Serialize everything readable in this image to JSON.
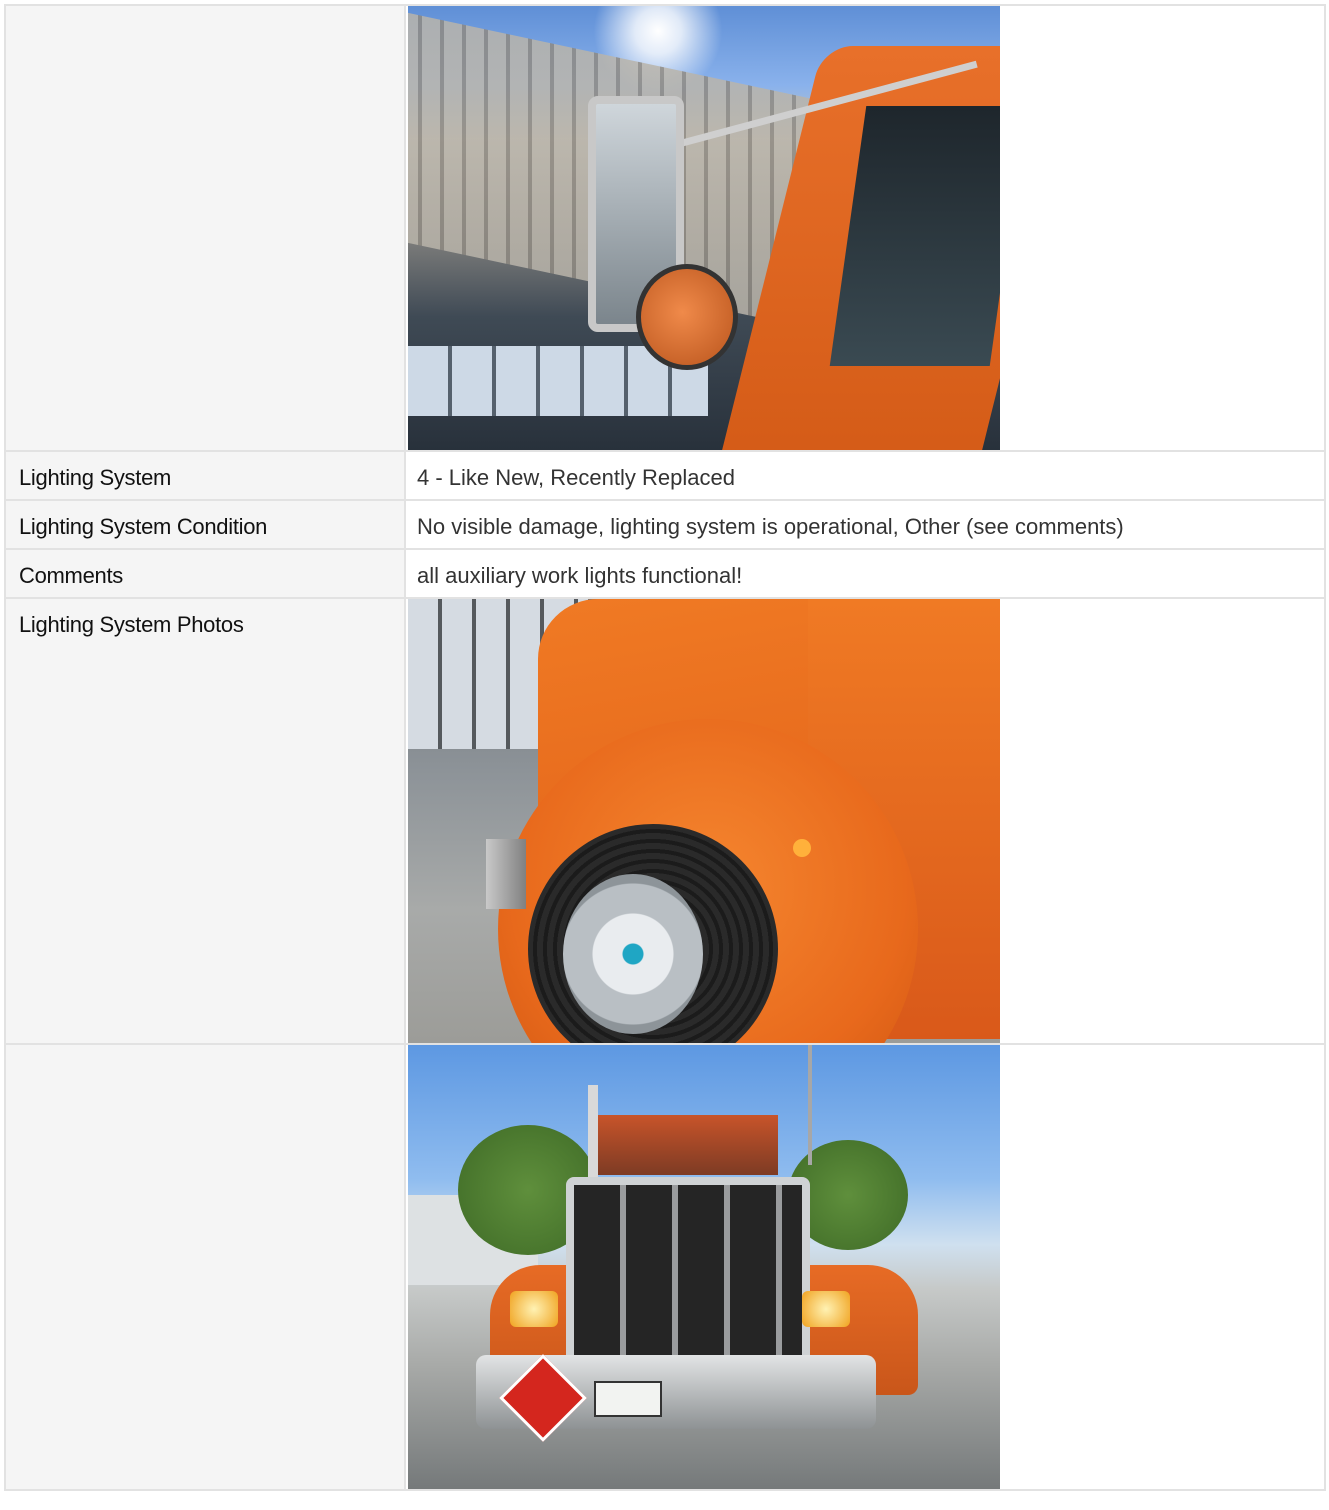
{
  "rows": [
    {
      "label": "",
      "type": "photo",
      "photo": "side-mirror-photo"
    },
    {
      "label": "Lighting System",
      "type": "text",
      "value": "4 - Like New, Recently Replaced"
    },
    {
      "label": "Lighting System Condition",
      "type": "text",
      "value": "No visible damage, lighting system is operational, Other (see comments)"
    },
    {
      "label": "Comments",
      "type": "text",
      "value": "all auxiliary work lights functional!"
    },
    {
      "label": "Lighting System Photos",
      "type": "photo",
      "photo": "front-fender-wheel-photo"
    },
    {
      "label": "",
      "type": "photo",
      "photo": "truck-front-photo"
    }
  ]
}
